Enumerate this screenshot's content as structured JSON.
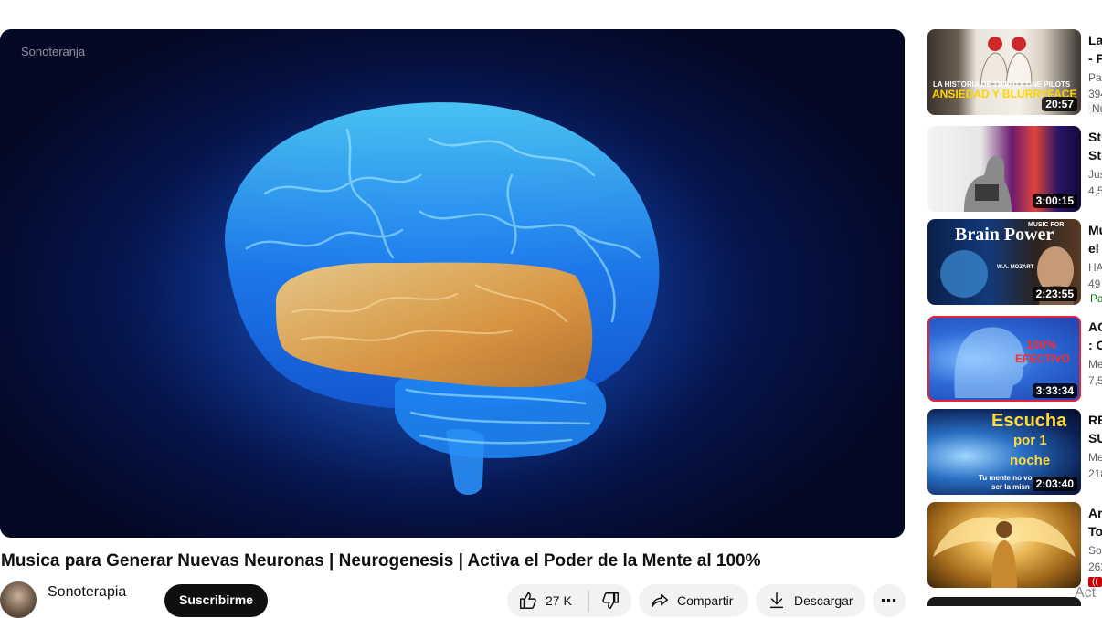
{
  "player": {
    "watermark": "Sonoteranja"
  },
  "video": {
    "title": "Musica para Generar Nuevas Neuronas | Neurogenesis | Activa el Poder de la Mente al 100%",
    "channel": "Sonoterapia",
    "subscribe_label": "Suscribirme",
    "like_count": "27 K",
    "share_label": "Compartir",
    "download_label": "Descargar"
  },
  "recommendations": [
    {
      "title_1": "La",
      "title_2": "- P",
      "meta_1": "Par",
      "meta_2": "394",
      "badge": "Nu",
      "duration": "20:57",
      "thumb_text_1": "LA HISTORIA DE TWENTY ONE PILOTS",
      "thumb_text_2": "ANSIEDAD Y BLURRYFACE"
    },
    {
      "title_1": "Stu",
      "title_2": "Stu",
      "meta_1": "Jus",
      "meta_2": "4,5",
      "duration": "3:00:15"
    },
    {
      "title_1": "Mu",
      "title_2": "el",
      "meta_1": "HA",
      "meta_2": "49",
      "badge": "Pa",
      "duration": "2:23:55",
      "thumb_text_1": "Brain Power",
      "thumb_text_2": "MUSIC FOR",
      "thumb_text_3": "W.A. MOZART"
    },
    {
      "title_1": "AC",
      "title_2": ": O",
      "meta_1": "Me",
      "meta_2": "7,5",
      "duration": "3:33:34",
      "thumb_text_1": "100%",
      "thumb_text_2": "EFECTIVO"
    },
    {
      "title_1": "RE",
      "title_2": "SU",
      "meta_1": "Me",
      "meta_2": "218",
      "duration": "2:03:40",
      "thumb_text_1": "Escucha",
      "thumb_text_2": "por 1",
      "thumb_text_3": "noche",
      "thumb_text_4": "Tu mente no vo",
      "thumb_text_5": "ser la misn"
    },
    {
      "title_1": "Arc",
      "title_2": "To",
      "meta_1": "So",
      "meta_2": "262",
      "badge": "(("
    }
  ],
  "overlay": {
    "activate_text": "Act"
  },
  "colors": {
    "brain_blue": "#2f9bff",
    "temporal_lobe": "#f2a23a",
    "subscribe_bg": "#0f0f0f",
    "live_badge": "#cc0000"
  }
}
